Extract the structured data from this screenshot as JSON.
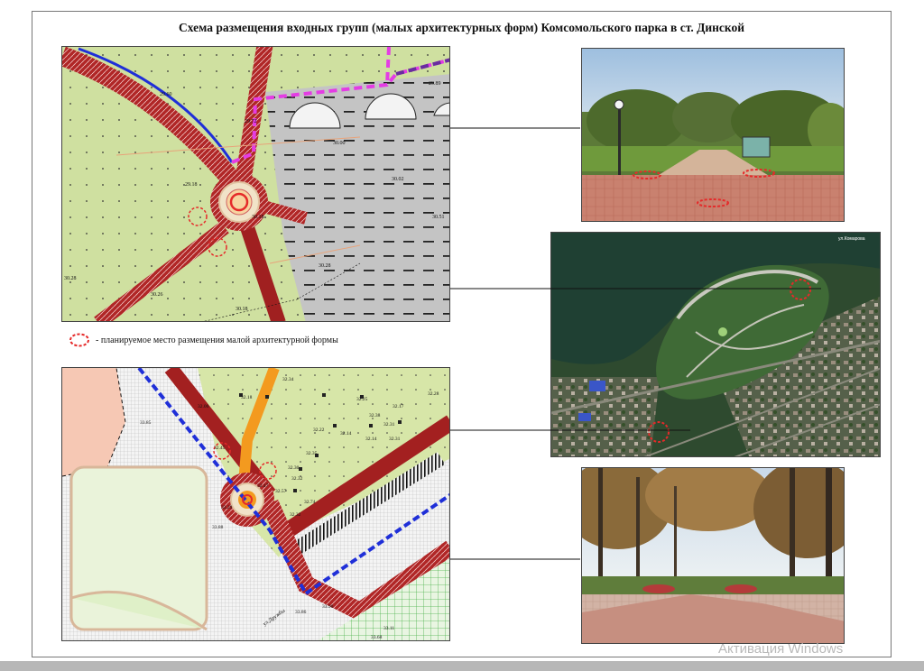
{
  "document": {
    "title": "Схема размещения входных групп (малых архитектурных форм) Комсомольского парка в ст. Динской"
  },
  "legend": {
    "label": "- планируемое место размещения малой архитектурной формы",
    "marker_icon": "red-dashed-circle-icon",
    "marker_color": "#e52a2a"
  },
  "map_top": {
    "elevations": [
      "29.60",
      "29.72",
      "29.18",
      "29.89",
      "30.00",
      "30.02",
      "30.51",
      "30.18",
      "30.28",
      "30.26",
      "30.18",
      "30.28"
    ]
  },
  "map_bottom": {
    "elevations": [
      "33.85",
      "32.18",
      "32.06",
      "32.45",
      "32.34",
      "32.28",
      "32.25",
      "32.17",
      "32.38",
      "32.22",
      "32.14",
      "32.14",
      "32.31",
      "32.31",
      "32.35",
      "32.30",
      "32.32",
      "32.57",
      "32.47",
      "32.74",
      "32.32",
      "33.29",
      "33.88",
      "33.90",
      "33.86",
      "33.11",
      "33.68"
    ],
    "street_labels": [
      "ул.Дружбы"
    ]
  },
  "satellite": {
    "caption": "ул.Комарова"
  },
  "watermark": {
    "text": "Активация Windows"
  },
  "colors": {
    "red_marker": "#e52a2a",
    "park_green": "#cfe0a0",
    "paving_red": "#b02626",
    "magenta_boundary": "#e43ce4",
    "blue_boundary": "#1f2fd8",
    "purple_boundary": "#6a2ca0"
  }
}
